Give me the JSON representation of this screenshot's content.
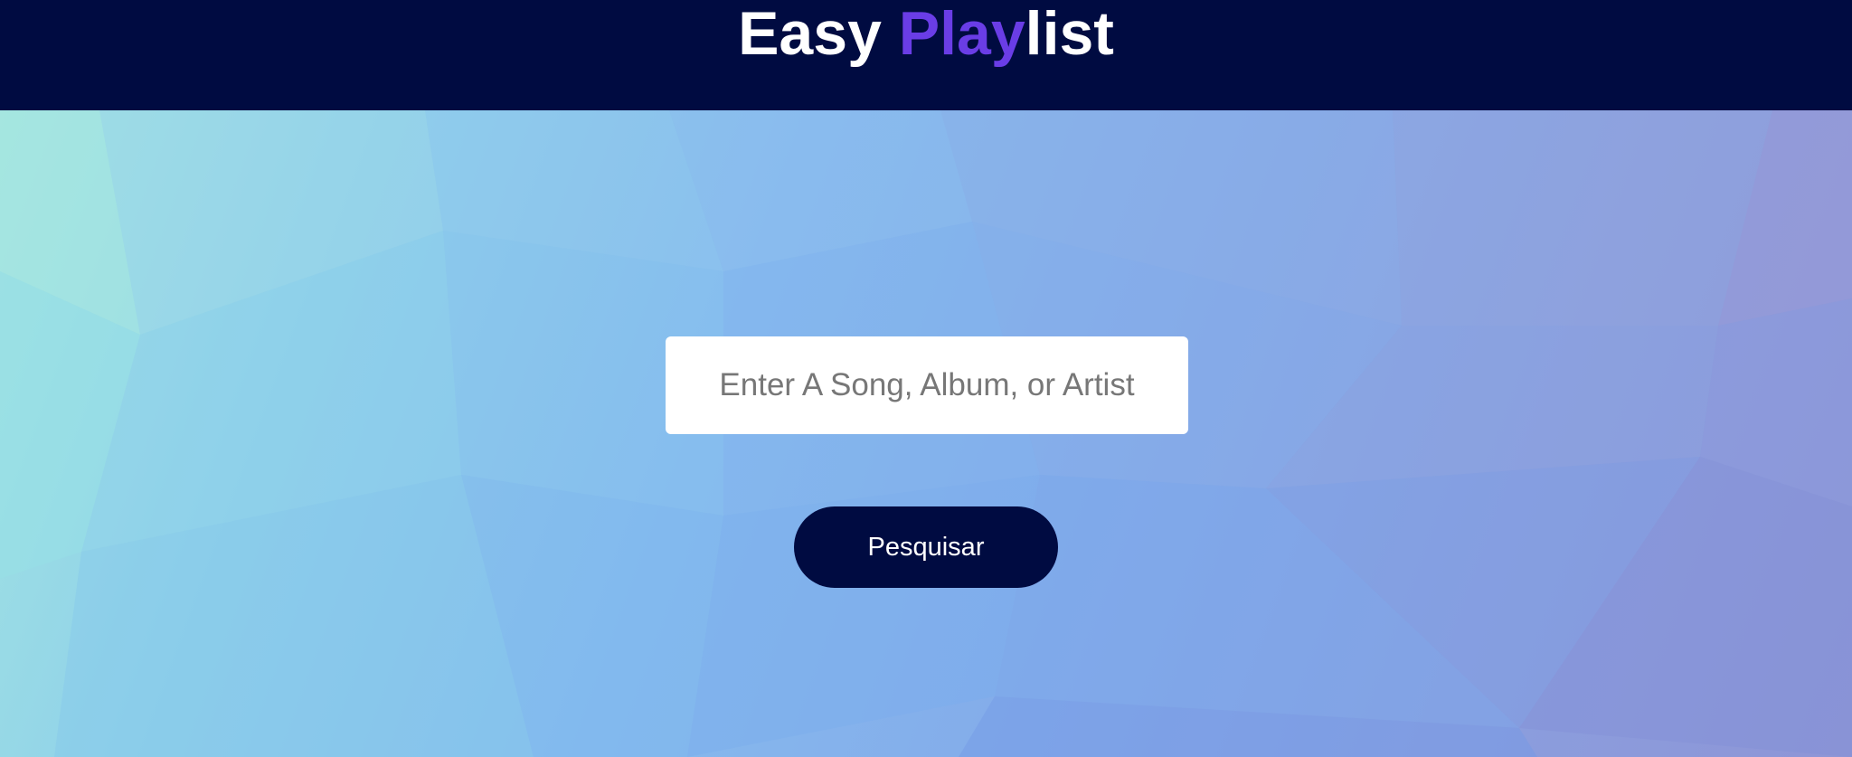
{
  "header": {
    "title_part1": "Easy ",
    "title_accent": "Play",
    "title_part2": "list"
  },
  "search": {
    "placeholder": "Enter A Song, Album, or Artist",
    "value": ""
  },
  "actions": {
    "search_button_label": "Pesquisar"
  },
  "colors": {
    "header_bg": "#000b41",
    "accent": "#6a3de6",
    "button_bg": "#000b41"
  }
}
